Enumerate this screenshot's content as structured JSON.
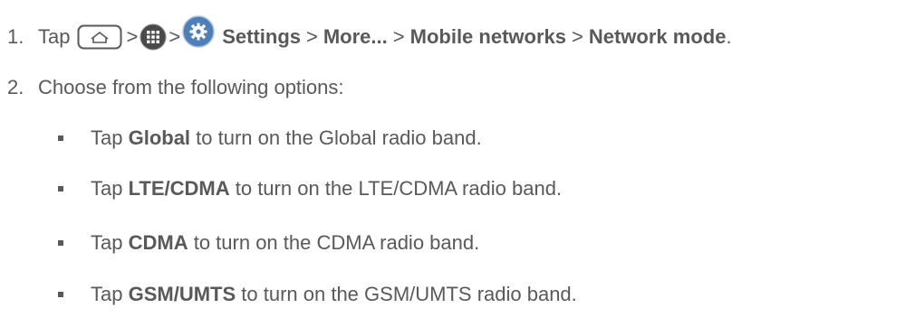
{
  "step1": {
    "number": "1.",
    "tap": "Tap",
    "sep1": ">",
    "sep2": ">",
    "settings": "Settings",
    "sep3": ">",
    "more": "More...",
    "sep4": ">",
    "mobile_networks": "Mobile networks",
    "sep5": ">",
    "network_mode": "Network mode",
    "period": ".",
    "icons": [
      "home-icon",
      "apps-icon",
      "settings-icon"
    ]
  },
  "step2": {
    "number": "2.",
    "text": "Choose from the following options:"
  },
  "options": [
    {
      "prefix": "Tap ",
      "bold": "Global",
      "suffix": " to turn on the Global radio band."
    },
    {
      "prefix": "Tap ",
      "bold": "LTE/CDMA",
      "suffix": " to turn on the LTE/CDMA radio band."
    },
    {
      "prefix": "Tap ",
      "bold": "CDMA",
      "suffix": " to turn on the CDMA radio band."
    },
    {
      "prefix": "Tap ",
      "bold": "GSM/UMTS",
      "suffix": " to turn on the GSM/UMTS radio band."
    }
  ],
  "colors": {
    "text": "#595959",
    "apps_icon_bg": "#4a4a4a",
    "settings_icon_bg": "#4f7fb8"
  }
}
